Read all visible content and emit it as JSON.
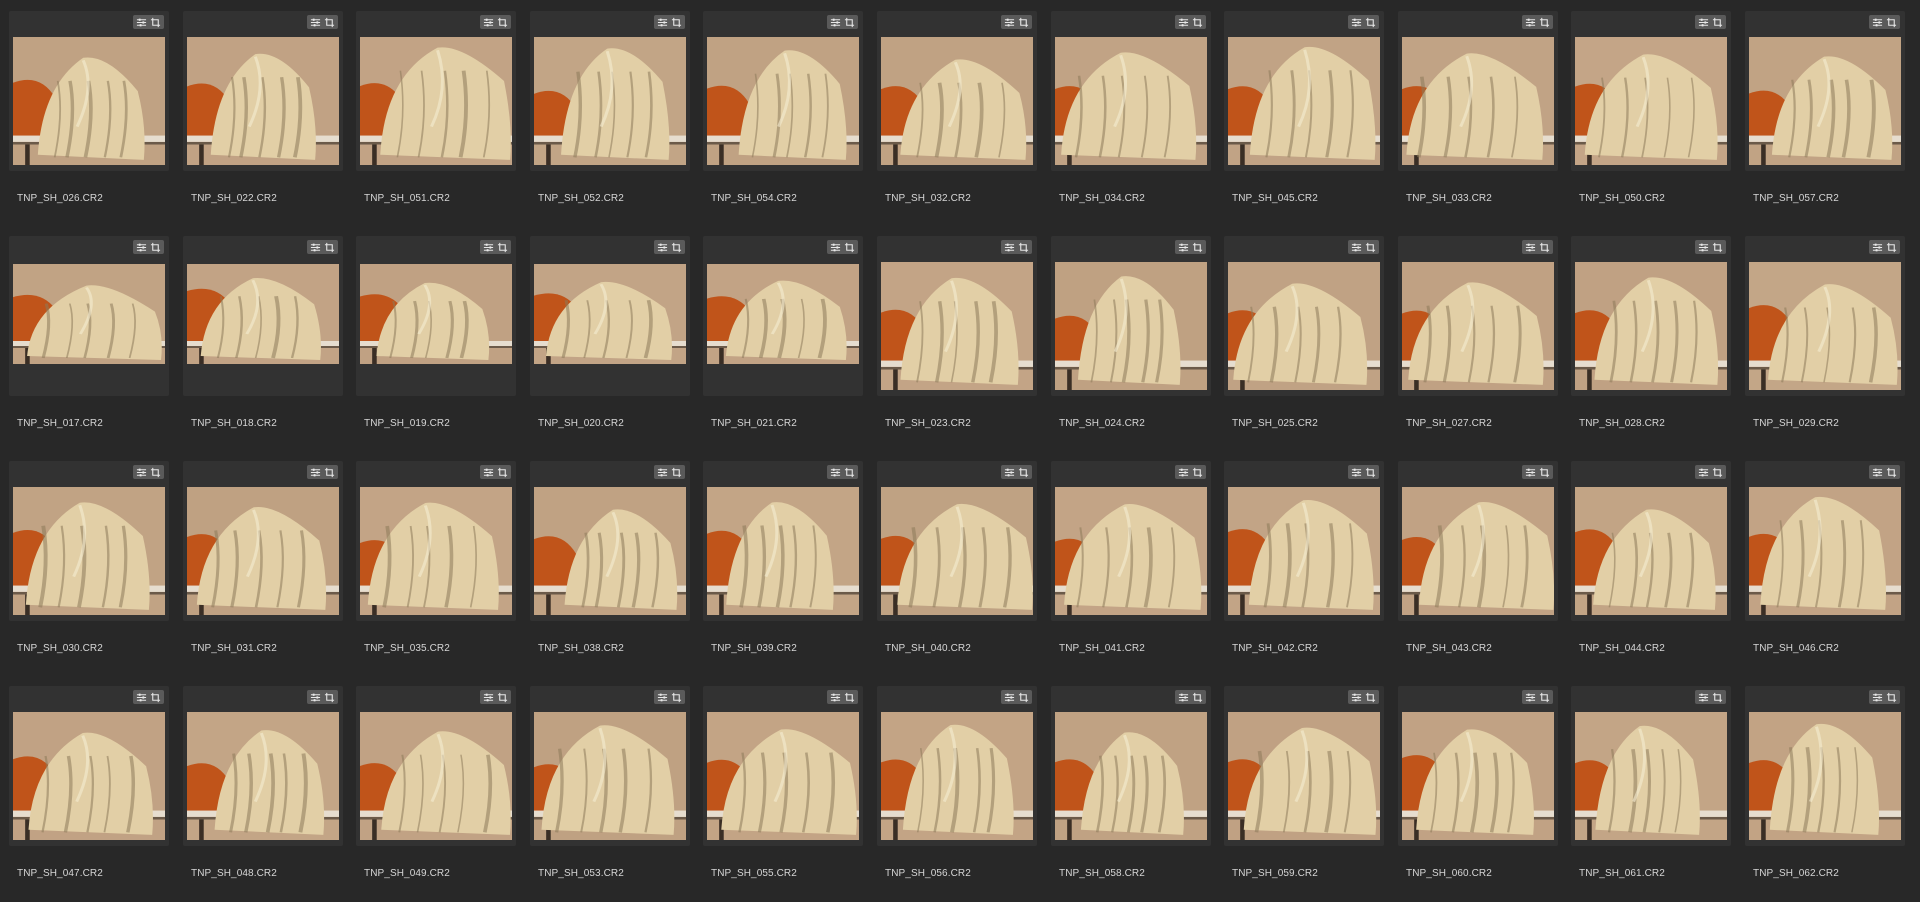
{
  "colors": {
    "background": "#282828",
    "card": "#323232",
    "filename_text": "#d6d6d6",
    "badge_bg": "#5a5a5a",
    "wall": "#c9ab8c",
    "cloth": "#e2cfa6",
    "skin": "#c0541a",
    "table": "#e6ddcf"
  },
  "badge_icons": [
    "adjustments-icon",
    "crop-icon"
  ],
  "rows": [
    {
      "thumb_aspect": "landscape",
      "files": [
        "TNP_SH_026.CR2",
        "TNP_SH_022.CR2",
        "TNP_SH_051.CR2",
        "TNP_SH_052.CR2",
        "TNP_SH_054.CR2",
        "TNP_SH_032.CR2",
        "TNP_SH_034.CR2",
        "TNP_SH_045.CR2",
        "TNP_SH_033.CR2",
        "TNP_SH_050.CR2",
        "TNP_SH_057.CR2"
      ]
    },
    {
      "thumb_aspect": "mixed",
      "files": [
        "TNP_SH_017.CR2",
        "TNP_SH_018.CR2",
        "TNP_SH_019.CR2",
        "TNP_SH_020.CR2",
        "TNP_SH_021.CR2",
        "TNP_SH_023.CR2",
        "TNP_SH_024.CR2",
        "TNP_SH_025.CR2",
        "TNP_SH_027.CR2",
        "TNP_SH_028.CR2",
        "TNP_SH_029.CR2"
      ]
    },
    {
      "thumb_aspect": "landscape",
      "files": [
        "TNP_SH_030.CR2",
        "TNP_SH_031.CR2",
        "TNP_SH_035.CR2",
        "TNP_SH_038.CR2",
        "TNP_SH_039.CR2",
        "TNP_SH_040.CR2",
        "TNP_SH_041.CR2",
        "TNP_SH_042.CR2",
        "TNP_SH_043.CR2",
        "TNP_SH_044.CR2",
        "TNP_SH_046.CR2"
      ]
    },
    {
      "thumb_aspect": "landscape",
      "files": [
        "TNP_SH_047.CR2",
        "TNP_SH_048.CR2",
        "TNP_SH_049.CR2",
        "TNP_SH_053.CR2",
        "TNP_SH_055.CR2",
        "TNP_SH_056.CR2",
        "TNP_SH_058.CR2",
        "TNP_SH_059.CR2",
        "TNP_SH_060.CR2",
        "TNP_SH_061.CR2",
        "TNP_SH_062.CR2"
      ]
    }
  ],
  "panoramic_thumbs": [
    "TNP_SH_017.CR2",
    "TNP_SH_018.CR2",
    "TNP_SH_019.CR2",
    "TNP_SH_020.CR2",
    "TNP_SH_021.CR2"
  ]
}
